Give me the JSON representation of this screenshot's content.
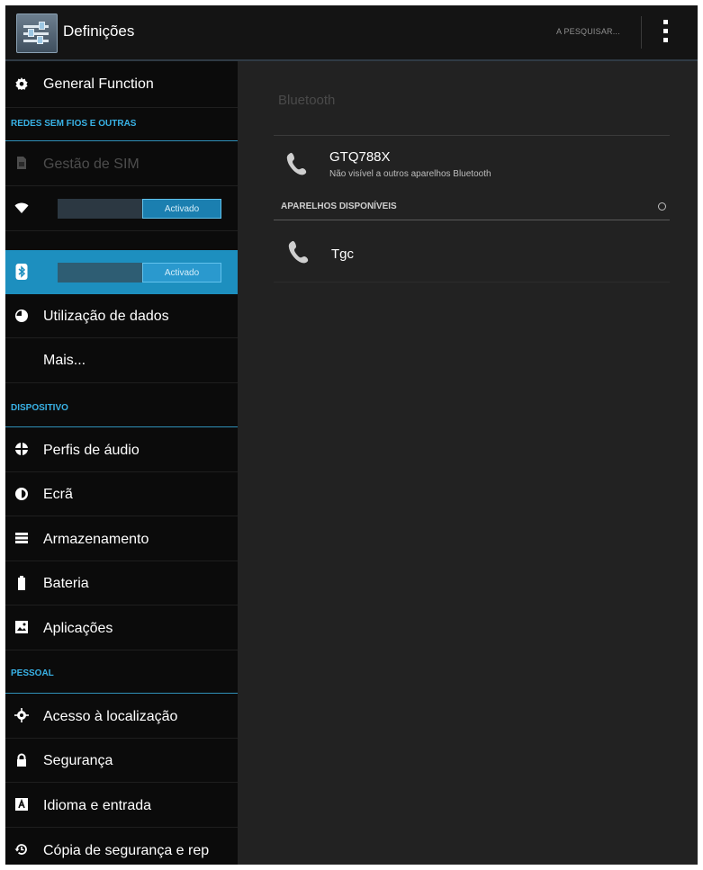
{
  "app": {
    "title": "Definições",
    "search_label": "A PESQUISAR...",
    "settings-icon": "settings-icon",
    "overflow-icon": "overflow-menu-icon"
  },
  "sidebar": {
    "general_function": "General Function",
    "section_wireless": "REDES SEM FIOS E OUTRAS",
    "sim": "Gestão de SIM",
    "wifi_toggle": "Activado",
    "bluetooth_toggle": "Activado",
    "data_usage": "Utilização de dados",
    "more": "Mais...",
    "section_device": "DISPOSITIVO",
    "audio_profiles": "Perfis de áudio",
    "display": "Ecrã",
    "storage": "Armazenamento",
    "battery": "Bateria",
    "apps": "Aplicações",
    "section_personal": "PESSOAL",
    "location": "Acesso à localização",
    "security": "Segurança",
    "language": "Idioma e entrada",
    "backup": "Cópia de segurança e rep"
  },
  "bluetooth": {
    "title": "Bluetooth",
    "this_device_name": "GTQ788X",
    "this_device_status": "Não visível a outros aparelhos Bluetooth",
    "available_header": "APARELHOS DISPONÍVEIS",
    "available_devices": [
      "Tgc"
    ]
  },
  "colors": {
    "accent": "#1d8fbf",
    "section_header": "#39b2e6",
    "pane_left": "#0b0b0b",
    "pane_right": "#222222"
  }
}
